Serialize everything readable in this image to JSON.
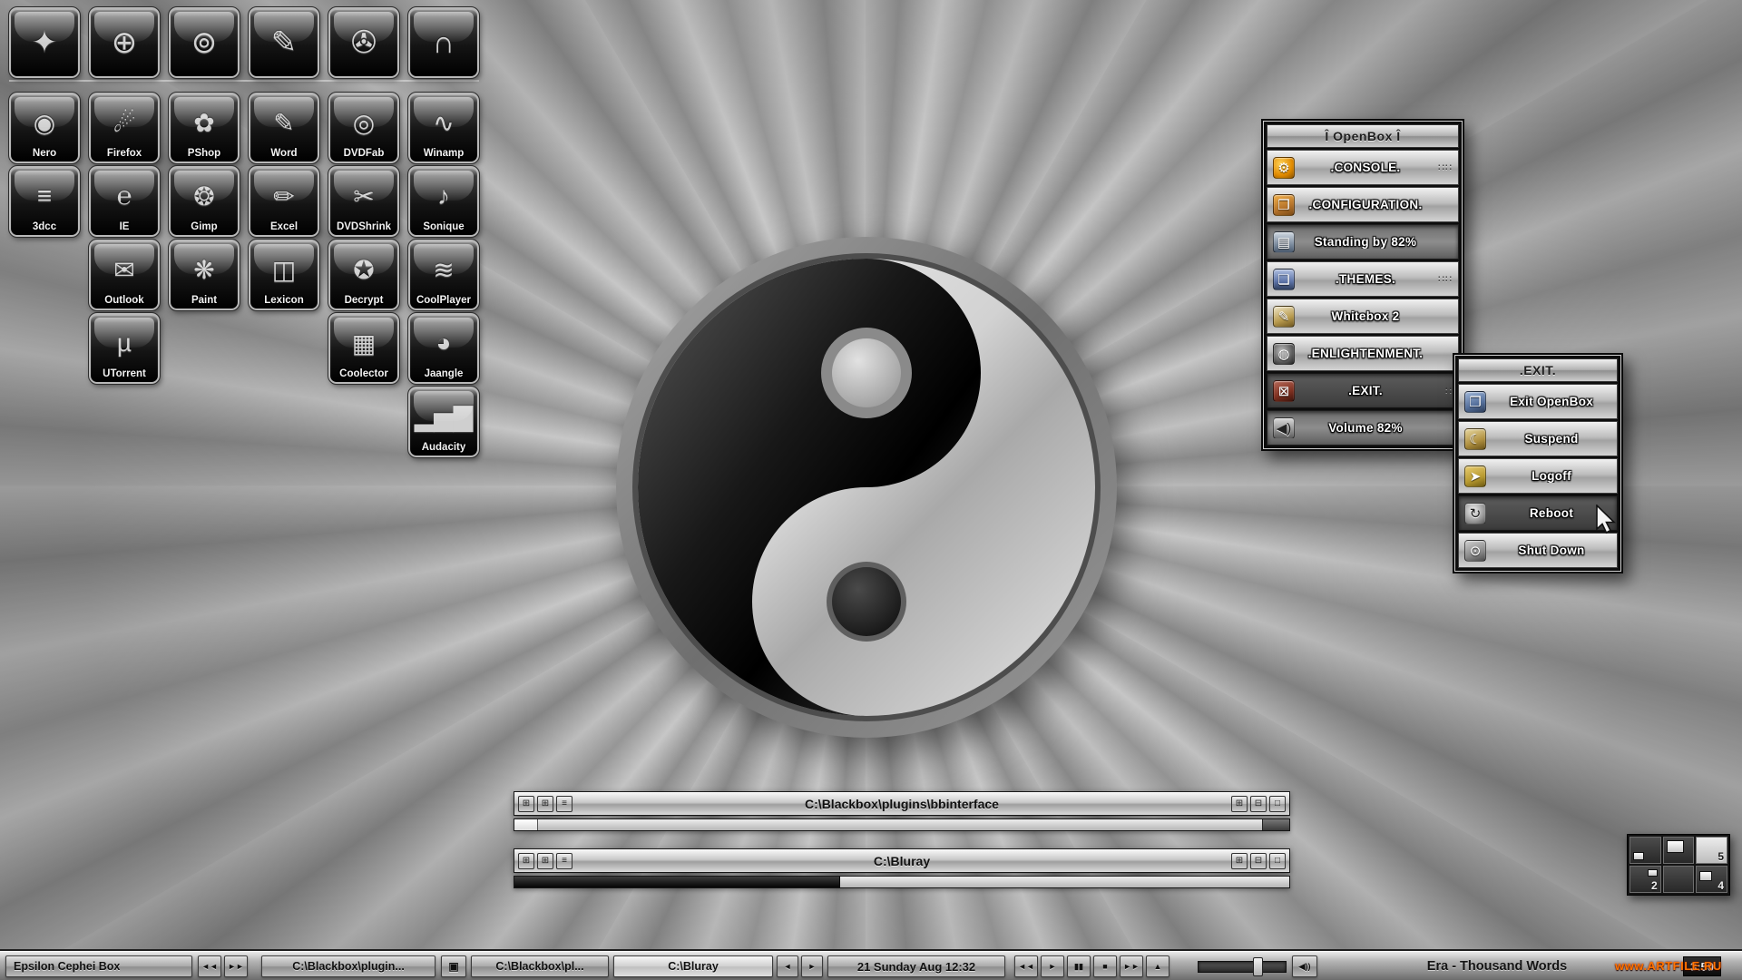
{
  "colors": {
    "accent_orange": "#e8940a",
    "watermark_orange": "#ff7300",
    "metal_light": "#c6c6c6",
    "metal_dark": "#6c6c6c",
    "menu_text": "#ffffff"
  },
  "dock": {
    "quick_row": [
      {
        "name": "launcher",
        "glyph": "✦"
      },
      {
        "name": "web-globe",
        "glyph": "⊕"
      },
      {
        "name": "robot",
        "glyph": "⊚"
      },
      {
        "name": "notepad",
        "glyph": "✎"
      },
      {
        "name": "video-camera",
        "glyph": "✇"
      },
      {
        "name": "headphones",
        "glyph": "∩"
      }
    ],
    "columns": [
      [
        {
          "label": "Nero",
          "glyph": "◉"
        },
        {
          "label": "3dcc",
          "glyph": "≡"
        }
      ],
      [
        {
          "label": "Firefox",
          "glyph": "☄"
        },
        {
          "label": "IE",
          "glyph": "℮"
        },
        {
          "label": "Outlook",
          "glyph": "✉"
        },
        {
          "label": "UTorrent",
          "glyph": "µ"
        }
      ],
      [
        {
          "label": "PShop",
          "glyph": "✿"
        },
        {
          "label": "Gimp",
          "glyph": "❂"
        },
        {
          "label": "Paint",
          "glyph": "❋"
        }
      ],
      [
        {
          "label": "Word",
          "glyph": "✎"
        },
        {
          "label": "Excel",
          "glyph": "✏"
        },
        {
          "label": "Lexicon",
          "glyph": "◫"
        }
      ],
      [
        {
          "label": "DVDFab",
          "glyph": "◎"
        },
        {
          "label": "DVDShrink",
          "glyph": "✂"
        },
        {
          "label": "Decrypt",
          "glyph": "✪"
        },
        {
          "label": "Coolector",
          "glyph": "▦"
        }
      ],
      [
        {
          "label": "Winamp",
          "glyph": "∿"
        },
        {
          "label": "Sonique",
          "glyph": "♪"
        },
        {
          "label": "CoolPlayer",
          "glyph": "≋"
        },
        {
          "label": "Jaangle",
          "glyph": "◕"
        },
        {
          "label": "Audacity",
          "glyph": "▂▅▇"
        }
      ]
    ]
  },
  "openbox_menu": {
    "title": "Î OpenBox Î",
    "items": [
      {
        "label": ".CONSOLE.",
        "glyph": "⚙",
        "submenu_glyph": "∷∷"
      },
      {
        "label": ".CONFIGURATION.",
        "glyph": "❒"
      },
      {
        "label": "Standing by  82%",
        "glyph": "▤",
        "pressed": true,
        "percent": 82
      },
      {
        "label": ".THEMES.",
        "glyph": "❏",
        "submenu_glyph": "∷∷"
      },
      {
        "label": "Whitebox 2",
        "glyph": "✎"
      },
      {
        "label": ".ENLIGHTENMENT.",
        "glyph": "◍"
      },
      {
        "label": ".EXIT.",
        "glyph": "⊠",
        "selected": true,
        "submenu_glyph": "∷"
      },
      {
        "label": "Volume  82%",
        "glyph": "◀)",
        "pressed": true,
        "percent": 82
      }
    ]
  },
  "exit_menu": {
    "title": ".EXIT.",
    "items": [
      {
        "label": "Exit OpenBox",
        "glyph": "❐"
      },
      {
        "label": "Suspend",
        "glyph": "☾"
      },
      {
        "label": "Logoff",
        "glyph": "➤"
      },
      {
        "label": "Reboot",
        "glyph": "↻",
        "selected": true
      },
      {
        "label": "Shut Down",
        "glyph": "⊙"
      }
    ]
  },
  "windows": [
    {
      "title": "C:\\Blackbox\\plugins\\bbinterface",
      "left_buttons": [
        "⊞",
        "⊞",
        "≡"
      ],
      "right_buttons": [
        "⊞",
        "⊟",
        "□"
      ],
      "slider_percent": 3
    },
    {
      "title": "C:\\Bluray",
      "left_buttons": [
        "⊞",
        "⊞",
        "≡"
      ],
      "right_buttons": [
        "⊞",
        "⊟",
        "□"
      ],
      "slider_percent": 42
    }
  ],
  "pager": {
    "cells": [
      {
        "label": "",
        "has_window": true
      },
      {
        "label": "",
        "has_window": true
      },
      {
        "label": "5",
        "has_window": false
      },
      {
        "label": "2",
        "has_window": true
      },
      {
        "label": "",
        "has_window": false
      },
      {
        "label": "4",
        "has_window": true
      }
    ]
  },
  "taskbar": {
    "workspace": "Epsilon Cephei Box",
    "arrows": {
      "prev": "◄◄",
      "next": "►►",
      "prev2": "◄",
      "next2": "►"
    },
    "tasks": [
      "C:\\Blackbox\\plugin...",
      "C:\\Blackbox\\pl...",
      "C:\\Bluray"
    ],
    "icon_task_glyph": "▣",
    "clock": "21 Sunday Aug 12:32",
    "media": [
      "◄◄",
      "►",
      "▮▮",
      "■",
      "►►",
      "▲"
    ],
    "speaker_glyph": "◀))",
    "volume_percent": 62,
    "track": "Era - Thousand Words",
    "time": "3:50"
  },
  "watermark": "www.ARTFILE.RU"
}
